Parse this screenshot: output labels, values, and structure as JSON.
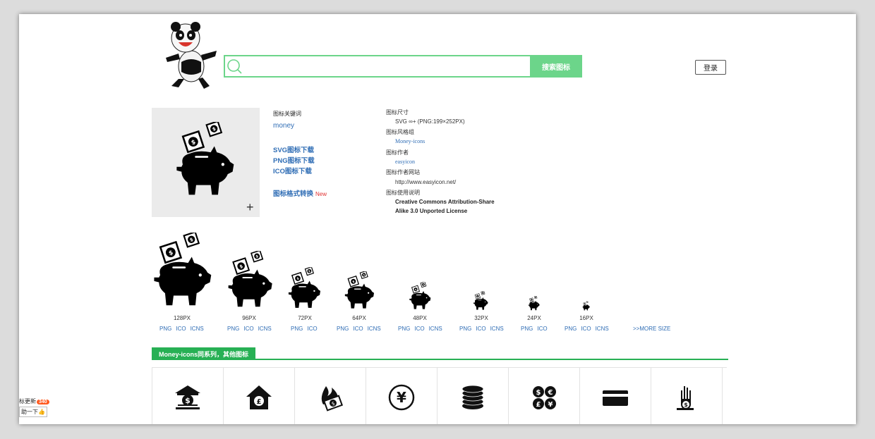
{
  "header": {
    "search_placeholder": "",
    "search_button": "搜索图标",
    "login_button": "登录"
  },
  "info": {
    "keyword_label": "图标关键词",
    "keyword": "money",
    "downloads": [
      "SVG图标下载",
      "PNG图标下载",
      "ICO图标下载"
    ],
    "convert_label": "图标格式转换",
    "new_badge": "New"
  },
  "meta": {
    "size_label": "图标尺寸",
    "size_value": "SVG ∞+ (PNG:199×252PX)",
    "style_label": "图标风格组",
    "style_value": "Money-icons",
    "author_label": "图标作者",
    "author_value": "easyicon",
    "site_label": "图标作者网站",
    "site_value": "http://www.easyicon.net/",
    "license_label": "图标使用说明",
    "license_line1": "Creative Commons Attribution-Share",
    "license_line2": "Alike 3.0 Unported License"
  },
  "sizes": [
    {
      "label": "128PX",
      "formats": [
        "PNG",
        "ICO",
        "ICNS"
      ]
    },
    {
      "label": "96PX",
      "formats": [
        "PNG",
        "ICO",
        "ICNS"
      ]
    },
    {
      "label": "72PX",
      "formats": [
        "PNG",
        "ICO"
      ]
    },
    {
      "label": "64PX",
      "formats": [
        "PNG",
        "ICO",
        "ICNS"
      ]
    },
    {
      "label": "48PX",
      "formats": [
        "PNG",
        "ICO",
        "ICNS"
      ]
    },
    {
      "label": "32PX",
      "formats": [
        "PNG",
        "ICO",
        "ICNS"
      ]
    },
    {
      "label": "24PX",
      "formats": [
        "PNG",
        "ICO"
      ]
    },
    {
      "label": "16PX",
      "formats": [
        "PNG",
        "ICO",
        "ICNS"
      ]
    }
  ],
  "more_size": ">>MORE SIZE",
  "series_title": "Money-icons同系列，其他图标",
  "series_icons": [
    "bank-dollar-icon",
    "house-pound-icon",
    "burning-money-icon",
    "yen-circle-icon",
    "coin-stack-icon",
    "currency-coins-icon",
    "credit-card-icon",
    "hand-dollar-icon"
  ],
  "widget": {
    "text": "标更新",
    "badge": "340",
    "button": "助一下👍"
  },
  "colors": {
    "accent": "#27b054",
    "search_green": "#6cd58a",
    "link": "#2f6db5",
    "new_red": "#e03030"
  }
}
